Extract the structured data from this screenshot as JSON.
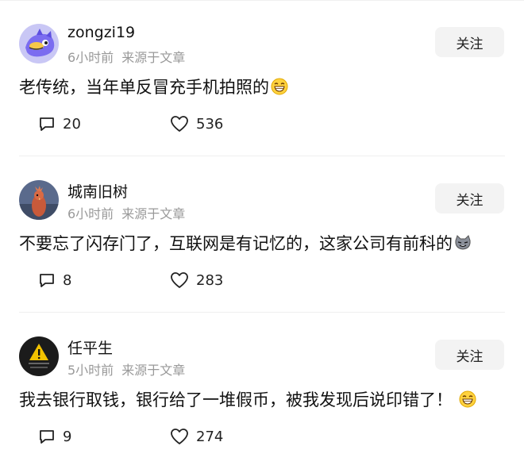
{
  "comments": [
    {
      "username": "zongzi19",
      "time": "6小时前",
      "source": "来源于文章",
      "follow_label": "关注",
      "text": "老传统，当年单反冒充手机拍照的",
      "emoji": "grin-emoji",
      "reply_count": "20",
      "like_count": "536"
    },
    {
      "username": "城南旧树",
      "time": "6小时前",
      "source": "来源于文章",
      "follow_label": "关注",
      "text": "不要忘了闪存门了，互联网是有记忆的，这家公司有前科的",
      "emoji": "cat-emoji",
      "reply_count": "8",
      "like_count": "283"
    },
    {
      "username": "任平生",
      "time": "5小时前",
      "source": "来源于文章",
      "follow_label": "关注",
      "text": "我去银行取钱，银行给了一堆假币，被我发现后说印错了！",
      "emoji": "grin-emoji",
      "reply_count": "9",
      "like_count": "274"
    }
  ],
  "colors": {
    "meta_text": "#999999",
    "follow_bg": "#f3f3f3",
    "text": "#111111"
  }
}
